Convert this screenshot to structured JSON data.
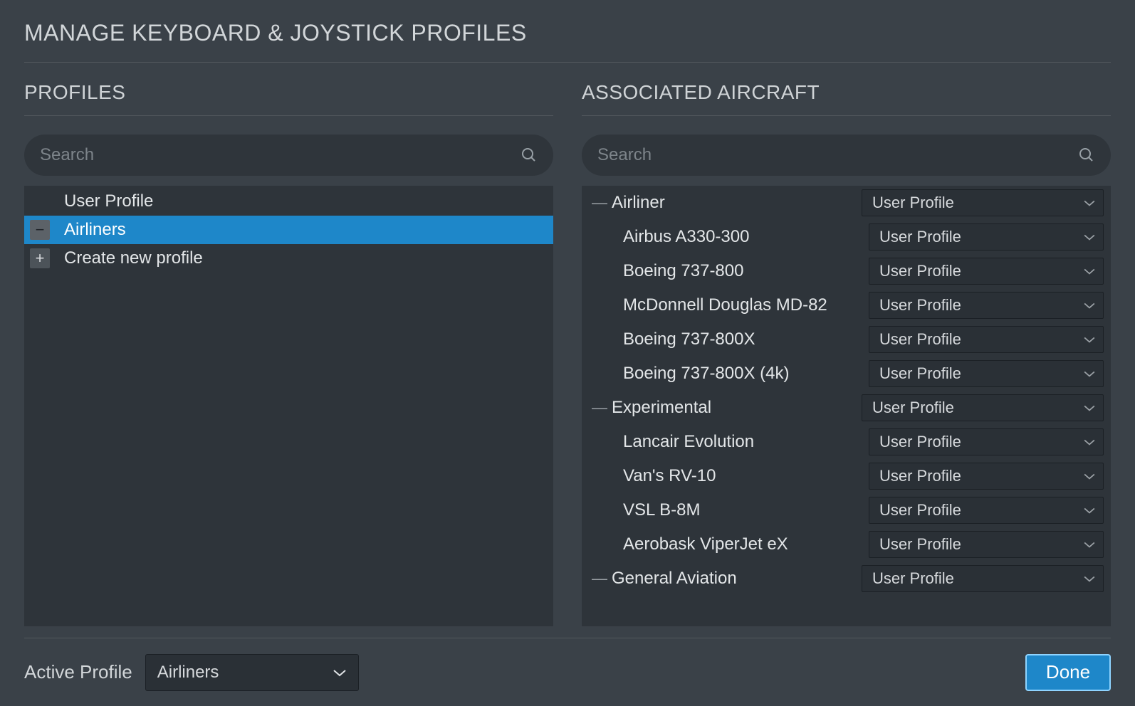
{
  "title": "MANAGE KEYBOARD & JOYSTICK PROFILES",
  "profiles_header": "PROFILES",
  "aircraft_header": "ASSOCIATED AIRCRAFT",
  "search_placeholder": "Search",
  "profiles": [
    {
      "label": "User Profile",
      "icon": "none",
      "selected": false
    },
    {
      "label": "Airliners",
      "icon": "minus",
      "selected": true
    },
    {
      "label": "Create new profile",
      "icon": "plus",
      "selected": false
    }
  ],
  "aircraft_groups": [
    {
      "label": "Airliner",
      "profile": "User Profile",
      "items": [
        {
          "label": "Airbus A330-300",
          "profile": "User Profile"
        },
        {
          "label": "Boeing 737-800",
          "profile": "User Profile"
        },
        {
          "label": "McDonnell Douglas MD-82",
          "profile": "User Profile"
        },
        {
          "label": "Boeing 737-800X",
          "profile": "User Profile"
        },
        {
          "label": "Boeing 737-800X (4k)",
          "profile": "User Profile"
        }
      ]
    },
    {
      "label": "Experimental",
      "profile": "User Profile",
      "items": [
        {
          "label": "Lancair Evolution",
          "profile": "User Profile"
        },
        {
          "label": "Van's RV-10",
          "profile": "User Profile"
        },
        {
          "label": "VSL B-8M",
          "profile": "User Profile"
        },
        {
          "label": "Aerobask ViperJet eX",
          "profile": "User Profile"
        }
      ]
    },
    {
      "label": "General Aviation",
      "profile": "User Profile",
      "items": []
    }
  ],
  "footer": {
    "active_label": "Active Profile",
    "active_value": "Airliners",
    "done_label": "Done"
  }
}
